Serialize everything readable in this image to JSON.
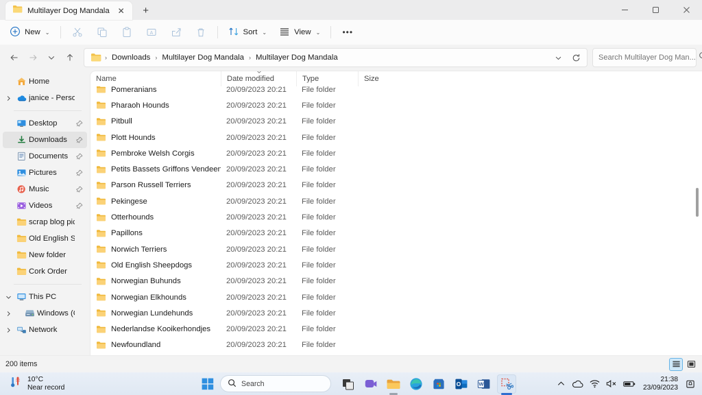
{
  "window": {
    "tab_title": "Multilayer Dog Mandala",
    "tab_close_label": "✕",
    "new_tab_label": "+",
    "minimize_label": "—",
    "maximize_label": "❐",
    "close_label": "✕"
  },
  "toolbar": {
    "new_label": "New",
    "new_chevron": "⌄",
    "cut_name": "cut",
    "copy_name": "copy",
    "paste_name": "paste",
    "rename_name": "rename",
    "share_name": "share",
    "delete_name": "delete",
    "sort_label": "Sort",
    "sort_chevron": "⌄",
    "view_label": "View",
    "view_chevron": "⌄",
    "more_label": "•••"
  },
  "addressbar": {
    "back_label": "←",
    "forward_label": "→",
    "recent_label": "⌄",
    "up_label": "↑",
    "crumbs": [
      "Downloads",
      "Multilayer Dog Mandala",
      "Multilayer Dog Mandala"
    ],
    "separator": "›",
    "history_chevron": "⌄",
    "refresh_label": "⟳"
  },
  "search": {
    "placeholder": "Search Multilayer Dog Man...",
    "value": "",
    "icon": "search-icon"
  },
  "navpane": {
    "items": [
      {
        "label": "Home",
        "icon": "home-icon",
        "expander": "",
        "pin": false,
        "selected": false,
        "indent": 1
      },
      {
        "label": "janice - Personal",
        "icon": "onedrive-icon",
        "expander": "›",
        "pin": false,
        "selected": false,
        "indent": 0
      },
      {
        "separator": true
      },
      {
        "label": "Desktop",
        "icon": "desktop-icon",
        "expander": "",
        "pin": true,
        "selected": false,
        "indent": 1
      },
      {
        "label": "Downloads",
        "icon": "downloads-icon",
        "expander": "",
        "pin": true,
        "selected": true,
        "indent": 1
      },
      {
        "label": "Documents",
        "icon": "documents-icon",
        "expander": "",
        "pin": true,
        "selected": false,
        "indent": 1
      },
      {
        "label": "Pictures",
        "icon": "pictures-icon",
        "expander": "",
        "pin": true,
        "selected": false,
        "indent": 1
      },
      {
        "label": "Music",
        "icon": "music-icon",
        "expander": "",
        "pin": true,
        "selected": false,
        "indent": 1
      },
      {
        "label": "Videos",
        "icon": "videos-icon",
        "expander": "",
        "pin": true,
        "selected": false,
        "indent": 1
      },
      {
        "label": "scrap blog pics",
        "icon": "folder-icon",
        "expander": "",
        "pin": false,
        "selected": false,
        "indent": 1
      },
      {
        "label": "Old English Sheepd",
        "icon": "folder-icon",
        "expander": "",
        "pin": false,
        "selected": false,
        "indent": 1
      },
      {
        "label": "New folder",
        "icon": "folder-icon",
        "expander": "",
        "pin": false,
        "selected": false,
        "indent": 1
      },
      {
        "label": "Cork Order",
        "icon": "folder-icon",
        "expander": "",
        "pin": false,
        "selected": false,
        "indent": 1
      },
      {
        "separator": true
      },
      {
        "label": "This PC",
        "icon": "pc-icon",
        "expander": "⌄",
        "pin": false,
        "selected": false,
        "indent": 0
      },
      {
        "label": "Windows (C:)",
        "icon": "drive-icon",
        "expander": "›",
        "pin": false,
        "selected": false,
        "indent": 2
      },
      {
        "label": "Network",
        "icon": "network-icon",
        "expander": "›",
        "pin": false,
        "selected": false,
        "indent": 0
      }
    ]
  },
  "filelist": {
    "columns": [
      {
        "label": "Name",
        "sorted": false
      },
      {
        "label": "Date modified",
        "sorted": true
      },
      {
        "label": "Type",
        "sorted": false
      },
      {
        "label": "Size",
        "sorted": false
      }
    ],
    "sort_glyph": "⌄",
    "rows": [
      {
        "name": "Pomeranians",
        "date": "20/09/2023 20:21",
        "type": "File folder",
        "size": ""
      },
      {
        "name": "Pharaoh Hounds",
        "date": "20/09/2023 20:21",
        "type": "File folder",
        "size": ""
      },
      {
        "name": "Pitbull",
        "date": "20/09/2023 20:21",
        "type": "File folder",
        "size": ""
      },
      {
        "name": "Plott Hounds",
        "date": "20/09/2023 20:21",
        "type": "File folder",
        "size": ""
      },
      {
        "name": "Pembroke Welsh Corgis",
        "date": "20/09/2023 20:21",
        "type": "File folder",
        "size": ""
      },
      {
        "name": "Petits Bassets Griffons Vendeens",
        "date": "20/09/2023 20:21",
        "type": "File folder",
        "size": ""
      },
      {
        "name": "Parson Russell Terriers",
        "date": "20/09/2023 20:21",
        "type": "File folder",
        "size": ""
      },
      {
        "name": "Pekingese",
        "date": "20/09/2023 20:21",
        "type": "File folder",
        "size": ""
      },
      {
        "name": "Otterhounds",
        "date": "20/09/2023 20:21",
        "type": "File folder",
        "size": ""
      },
      {
        "name": "Papillons",
        "date": "20/09/2023 20:21",
        "type": "File folder",
        "size": ""
      },
      {
        "name": "Norwich Terriers",
        "date": "20/09/2023 20:21",
        "type": "File folder",
        "size": ""
      },
      {
        "name": "Old English Sheepdogs",
        "date": "20/09/2023 20:21",
        "type": "File folder",
        "size": ""
      },
      {
        "name": "Norwegian Buhunds",
        "date": "20/09/2023 20:21",
        "type": "File folder",
        "size": ""
      },
      {
        "name": "Norwegian Elkhounds",
        "date": "20/09/2023 20:21",
        "type": "File folder",
        "size": ""
      },
      {
        "name": "Norwegian Lundehunds",
        "date": "20/09/2023 20:21",
        "type": "File folder",
        "size": ""
      },
      {
        "name": "Nederlandse Kooikerhondjes",
        "date": "20/09/2023 20:21",
        "type": "File folder",
        "size": ""
      },
      {
        "name": "Newfoundland",
        "date": "20/09/2023 20:21",
        "type": "File folder",
        "size": ""
      },
      {
        "name": "",
        "date": "",
        "type": "",
        "size": ""
      }
    ]
  },
  "statusbar": {
    "item_count": "200 items",
    "details_view": "details-view",
    "icons_view": "large-icons-view"
  },
  "taskbar": {
    "weather_temp": "10°C",
    "weather_desc": "Near record",
    "start_label": "start-button",
    "search_placeholder": "Search",
    "apps": [
      {
        "name": "task-view",
        "active": false,
        "underline": false
      },
      {
        "name": "chat-teams",
        "active": false,
        "underline": false
      },
      {
        "name": "file-explorer",
        "active": false,
        "underline": true
      },
      {
        "name": "microsoft-edge",
        "active": false,
        "underline": false
      },
      {
        "name": "microsoft-store",
        "active": false,
        "underline": false
      },
      {
        "name": "outlook",
        "active": false,
        "underline": false
      },
      {
        "name": "word",
        "active": false,
        "underline": false
      },
      {
        "name": "snipping-tool",
        "active": true,
        "underline": "accent"
      }
    ],
    "tray": {
      "overflow": "^",
      "onedrive": "onedrive-icon",
      "wifi": "wifi-icon",
      "volume": "volume-muted-icon",
      "battery": "battery-icon",
      "time": "21:38",
      "date": "23/09/2023",
      "notifications": "notification-bell-icon"
    }
  },
  "colors": {
    "folder_yellow": "#f7c662",
    "accent_blue": "#0067c0",
    "selection_grey": "#e4e4e4"
  }
}
